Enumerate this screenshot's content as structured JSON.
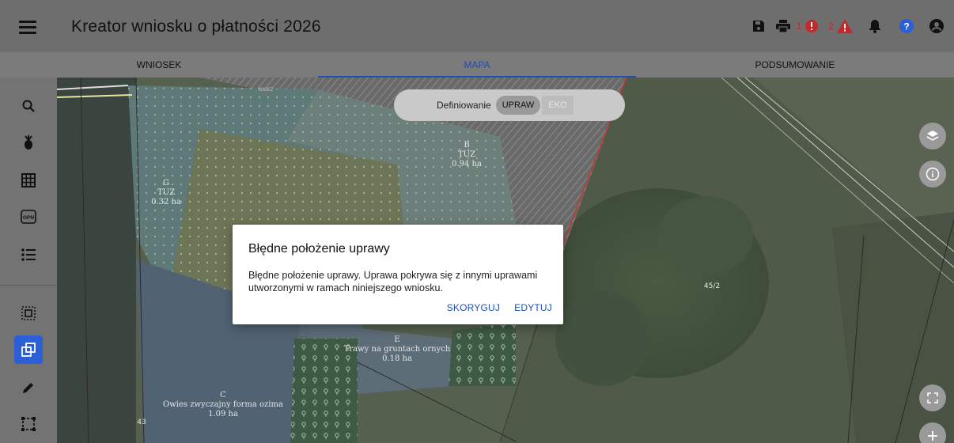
{
  "header": {
    "title": "Kreator wniosku o płatności 2026",
    "icons": [
      "menu-icon",
      "save-icon",
      "print-icon",
      "error-icon",
      "warning-icon",
      "bell-icon",
      "help-icon",
      "account-icon"
    ],
    "error_count": "1",
    "warning_count": "2"
  },
  "tabs": [
    {
      "label": "WNIOSEK"
    },
    {
      "label": "MAPA"
    },
    {
      "label": "PODSUMOWANIE"
    }
  ],
  "toolbar": {
    "icons": [
      "search-icon",
      "crop-icon",
      "grid-icon",
      "opn-icon",
      "list-icon",
      "select-dots-icon",
      "overlap-icon",
      "pencil-icon",
      "rectangle-select-icon"
    ],
    "opn_text": "OPN"
  },
  "map": {
    "pill": {
      "label": "Definiowanie",
      "option_on": "UPRAW",
      "option_off": "EKO"
    },
    "labels": {
      "b": {
        "l1": "B",
        "l2": "TUZ",
        "l3": "0.94 ha"
      },
      "g": {
        "l1": "G",
        "l2": "TUZ",
        "l3": "0.32 ha"
      },
      "e": {
        "l1": "E",
        "l2": "Trawy na gruntach ornych",
        "l3": "0.18 ha"
      },
      "c": {
        "l1": "C",
        "l2": "Owies zwyczajny forma ozima",
        "l3": "1.09 ha"
      },
      "p452": "45/2",
      "p43": "43",
      "top": "GNIEZ"
    }
  },
  "dialog": {
    "title": "Błędne położenie uprawy",
    "message": "Błędne położenie uprawy. Uprawa pokrywa się z innymi uprawami utworzonymi w ramach niniejszego wniosku.",
    "btn_fix": "SKORYGUJ",
    "btn_edit": "EDYTUJ"
  },
  "colors": {
    "accent": "#1e4fb4",
    "error": "#c62828",
    "active_tool": "#2c5fd6"
  }
}
